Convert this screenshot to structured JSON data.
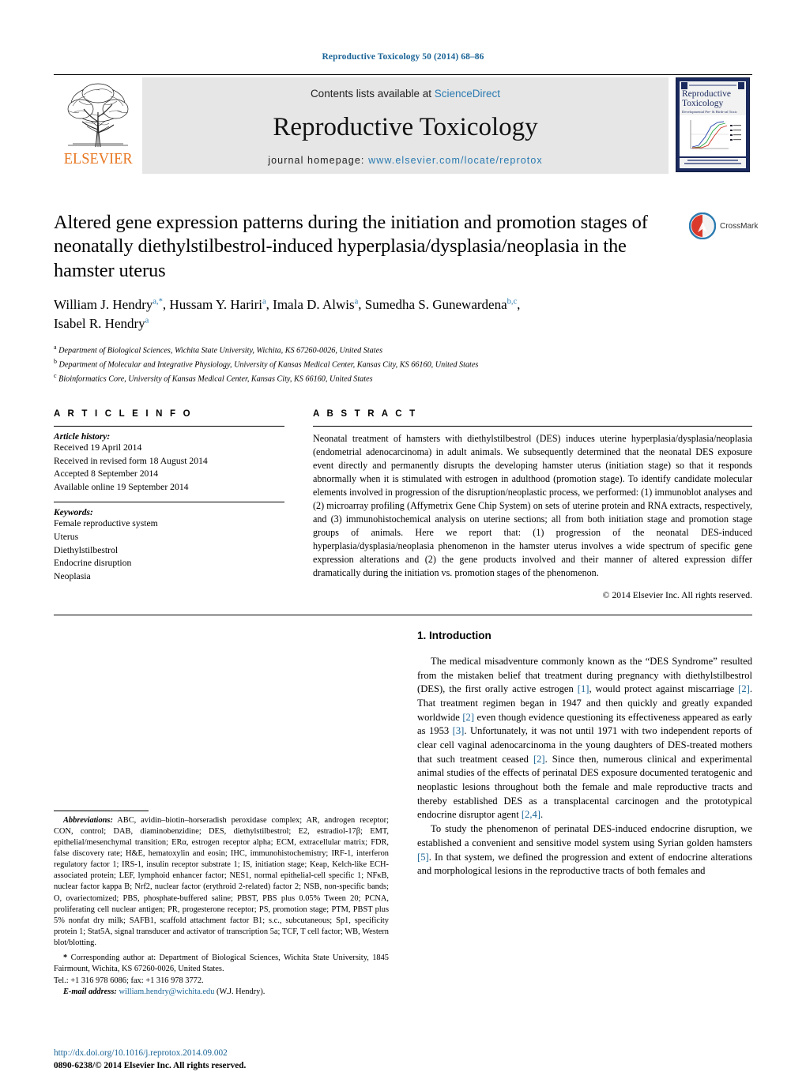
{
  "running_head": "Reproductive Toxicology 50 (2014) 68–86",
  "masthead": {
    "publisher": "ELSEVIER",
    "contents_prefix": "Contents lists available at ",
    "contents_link": "ScienceDirect",
    "journal_name": "Reproductive Toxicology",
    "homepage_prefix": "journal homepage: ",
    "homepage_url": "www.elsevier.com/locate/reprotox",
    "cover": {
      "title": "Reproductive Toxicology",
      "subtitle": "Developmental Pre- & Birth-ral Toxic"
    }
  },
  "article": {
    "title": "Altered gene expression patterns during the initiation and promotion stages of neonatally diethylstilbestrol-induced hyperplasia/dysplasia/neoplasia in the hamster uterus",
    "crossmark_label": "CrossMark",
    "authors_line_1": "William J. Hendry",
    "authors_html": "William J. Hendry<sup>a,*</sup>, Hussam Y. Hariri<sup>a</sup>, Imala D. Alwis<sup>a</sup>, Sumedha S. Gunewardena<sup>b,c</sup>, Isabel R. Hendry<sup>a</sup>",
    "affiliations": [
      {
        "sup": "a",
        "text": "Department of Biological Sciences, Wichita State University, Wichita, KS 67260-0026, United States"
      },
      {
        "sup": "b",
        "text": "Department of Molecular and Integrative Physiology, University of Kansas Medical Center, Kansas City, KS 66160, United States"
      },
      {
        "sup": "c",
        "text": "Bioinformatics Core, University of Kansas Medical Center, Kansas City, KS 66160, United States"
      }
    ]
  },
  "info": {
    "heading": "A R T I C L E   I N F O",
    "history_label": "Article history:",
    "history": [
      "Received 19 April 2014",
      "Received in revised form 18 August 2014",
      "Accepted 8 September 2014",
      "Available online 19 September 2014"
    ],
    "keywords_label": "Keywords:",
    "keywords": [
      "Female reproductive system",
      "Uterus",
      "Diethylstilbestrol",
      "Endocrine disruption",
      "Neoplasia"
    ]
  },
  "abstract": {
    "heading": "A B S T R A C T",
    "text": "Neonatal treatment of hamsters with diethylstilbestrol (DES) induces uterine hyperplasia/dysplasia/neoplasia (endometrial adenocarcinoma) in adult animals. We subsequently determined that the neonatal DES exposure event directly and permanently disrupts the developing hamster uterus (initiation stage) so that it responds abnormally when it is stimulated with estrogen in adulthood (promotion stage). To identify candidate molecular elements involved in progression of the disruption/neoplastic process, we performed: (1) immunoblot analyses and (2) microarray profiling (Affymetrix Gene Chip System) on sets of uterine protein and RNA extracts, respectively, and (3) immunohistochemical analysis on uterine sections; all from both initiation stage and promotion stage groups of animals. Here we report that: (1) progression of the neonatal DES-induced hyperplasia/dysplasia/neoplasia phenomenon in the hamster uterus involves a wide spectrum of specific gene expression alterations and (2) the gene products involved and their manner of altered expression differ dramatically during the initiation vs. promotion stages of the phenomenon.",
    "copyright": "© 2014 Elsevier Inc. All rights reserved."
  },
  "footnotes": {
    "abbreviations_label": "Abbreviations:",
    "abbreviations_text": "ABC, avidin–biotin–horseradish peroxidase complex; AR, androgen receptor; CON, control; DAB, diaminobenzidine; DES, diethylstilbestrol; E2, estradiol-17β; EMT, epithelial/mesenchymal transition; ERα, estrogen receptor alpha; ECM, extracellular matrix; FDR, false discovery rate; H&E, hematoxylin and eosin; IHC, immunohistochemistry; IRF-1, interferon regulatory factor 1; IRS-1, insulin receptor substrate 1; IS, initiation stage; Keap, Kelch-like ECH-associated protein; LEF, lymphoid enhancer factor; NES1, normal epithelial-cell specific 1; NFκB, nuclear factor kappa B; Nrf2, nuclear factor (erythroid 2-related) factor 2; NSB, non-specific bands; O, ovariectomized; PBS, phosphate-buffered saline; PBST, PBS plus 0.05% Tween 20; PCNA, proliferating cell nuclear antigen; PR, progesterone receptor; PS, promotion stage; PTM, PBST plus 5% nonfat dry milk; SAFB1, scaffold attachment factor B1; s.c., subcutaneous; Sp1, specificity protein 1; Stat5A, signal transducer and activator of transcription 5a; TCF, T cell factor; WB, Western blot/blotting.",
    "corresponding_text": "Corresponding author at: Department of Biological Sciences, Wichita State University, 1845 Fairmount, Wichita, KS 67260-0026, United States.",
    "tel_line": "Tel.: +1 316 978 6086; fax: +1 316 978 3772.",
    "email_label": "E-mail address:",
    "email": "william.hendry@wichita.edu",
    "email_suffix": "(W.J. Hendry)."
  },
  "doi_block": {
    "doi_url": "http://dx.doi.org/10.1016/j.reprotox.2014.09.002",
    "issn_line": "0890-6238/© 2014 Elsevier Inc. All rights reserved."
  },
  "introduction": {
    "heading": "1.  Introduction",
    "para1_a": "The medical misadventure commonly known as the “DES Syndrome” resulted from the mistaken belief that treatment during pregnancy with diethylstilbestrol (DES), the first orally active estrogen ",
    "cite1": "[1]",
    "para1_b": ", would protect against miscarriage ",
    "cite2": "[2]",
    "para1_c": ". That treatment regimen began in 1947 and then quickly and greatly expanded worldwide ",
    "cite3": "[2]",
    "para1_d": " even though evidence questioning its effectiveness appeared as early as 1953 ",
    "cite4": "[3]",
    "para1_e": ". Unfortunately, it was not until 1971 with two independent reports of clear cell vaginal adenocarcinoma in the young daughters of DES-treated mothers that such treatment ceased ",
    "cite5": "[2]",
    "para1_f": ". Since then, numerous clinical and experimental animal studies of the effects of perinatal DES exposure documented teratogenic and neoplastic lesions throughout both the female and male reproductive tracts and thereby established DES as a transplacental carcinogen and the prototypical endocrine disruptor agent ",
    "cite6": "[2,4]",
    "para1_g": ".",
    "para2_a": "To study the phenomenon of perinatal DES-induced endocrine disruption, we established a convenient and sensitive model system using Syrian golden hamsters ",
    "cite7": "[5]",
    "para2_b": ". In that system, we defined the progression and extent of endocrine alterations and morphological lesions in the reproductive tracts of both females and"
  },
  "colors": {
    "link_blue": "#1a6496",
    "sciencedirect_blue": "#2a7ab0",
    "elsevier_orange": "#E87722",
    "cover_navy": "#1b2a5e"
  }
}
